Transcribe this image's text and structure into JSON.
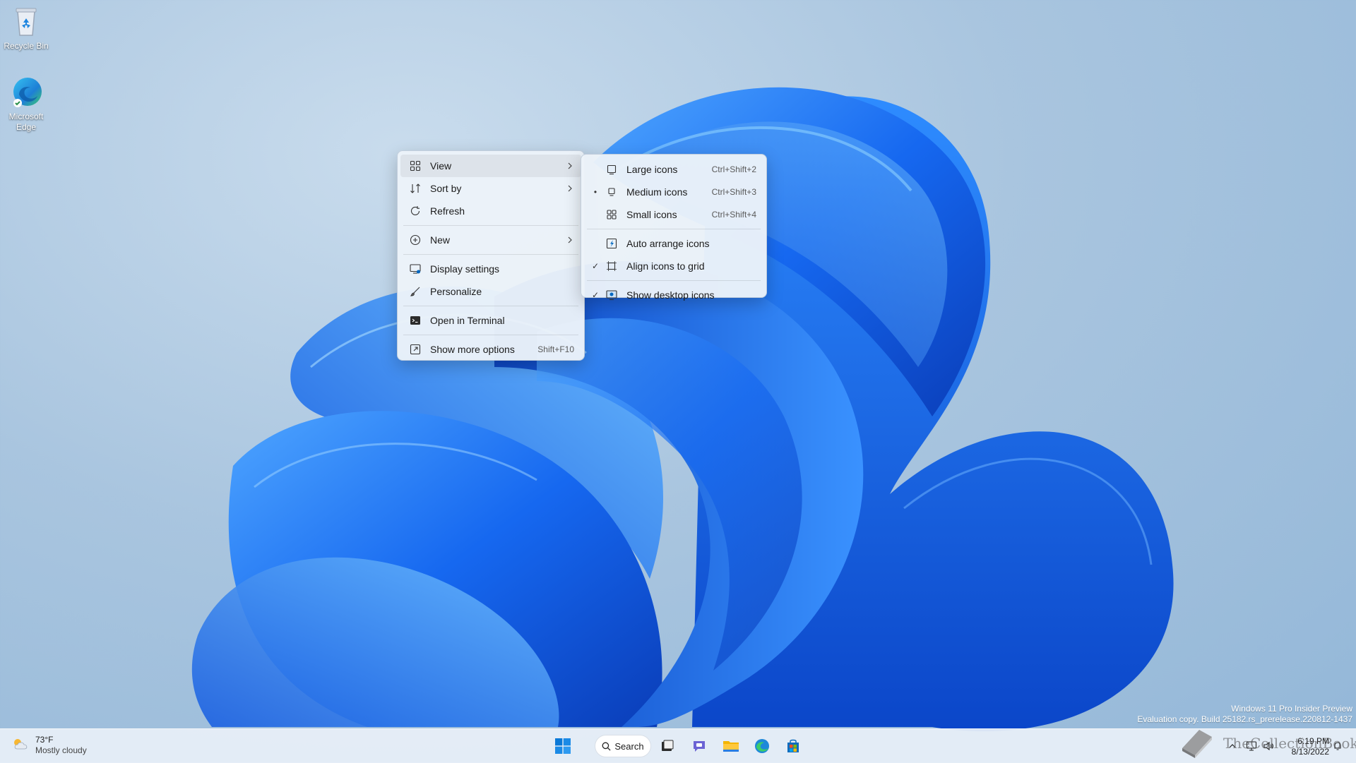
{
  "desktop": {
    "icons": [
      {
        "label": "Recycle Bin",
        "icon": "recycle-bin-icon"
      },
      {
        "label": "Microsoft Edge",
        "icon": "edge-icon"
      }
    ]
  },
  "context_menu": {
    "items": [
      {
        "label": "View",
        "icon": "view-grid-icon",
        "has_submenu": true
      },
      {
        "label": "Sort by",
        "icon": "sort-icon",
        "has_submenu": true
      },
      {
        "label": "Refresh",
        "icon": "refresh-icon"
      },
      {
        "label": "New",
        "icon": "new-plus-icon",
        "has_submenu": true
      },
      {
        "label": "Display settings",
        "icon": "display-icon"
      },
      {
        "label": "Personalize",
        "icon": "brush-icon"
      },
      {
        "label": "Open in Terminal",
        "icon": "terminal-icon"
      },
      {
        "label": "Show more options",
        "icon": "more-options-icon",
        "shortcut": "Shift+F10"
      }
    ]
  },
  "view_submenu": {
    "items": [
      {
        "label": "Large icons",
        "shortcut": "Ctrl+Shift+2",
        "state": ""
      },
      {
        "label": "Medium icons",
        "shortcut": "Ctrl+Shift+3",
        "state": "•"
      },
      {
        "label": "Small icons",
        "shortcut": "Ctrl+Shift+4",
        "state": ""
      },
      {
        "label": "Auto arrange icons",
        "state": ""
      },
      {
        "label": "Align icons to grid",
        "state": "✓"
      },
      {
        "label": "Show desktop icons",
        "state": "✓"
      }
    ]
  },
  "watermark": {
    "line1": "Windows 11 Pro Insider Preview",
    "line2": "Evaluation copy. Build 25182.rs_prerelease.220812-1437"
  },
  "taskbar": {
    "weather": {
      "temp": "73°F",
      "condition": "Mostly cloudy"
    },
    "search_label": "Search",
    "clock": {
      "time": "6:19 PM",
      "date": "8/13/2022"
    }
  },
  "overlay": {
    "text": "TheCollectionBook"
  },
  "colors": {
    "accent": "#0067c0",
    "menu_bg": "#ecf2f9"
  }
}
